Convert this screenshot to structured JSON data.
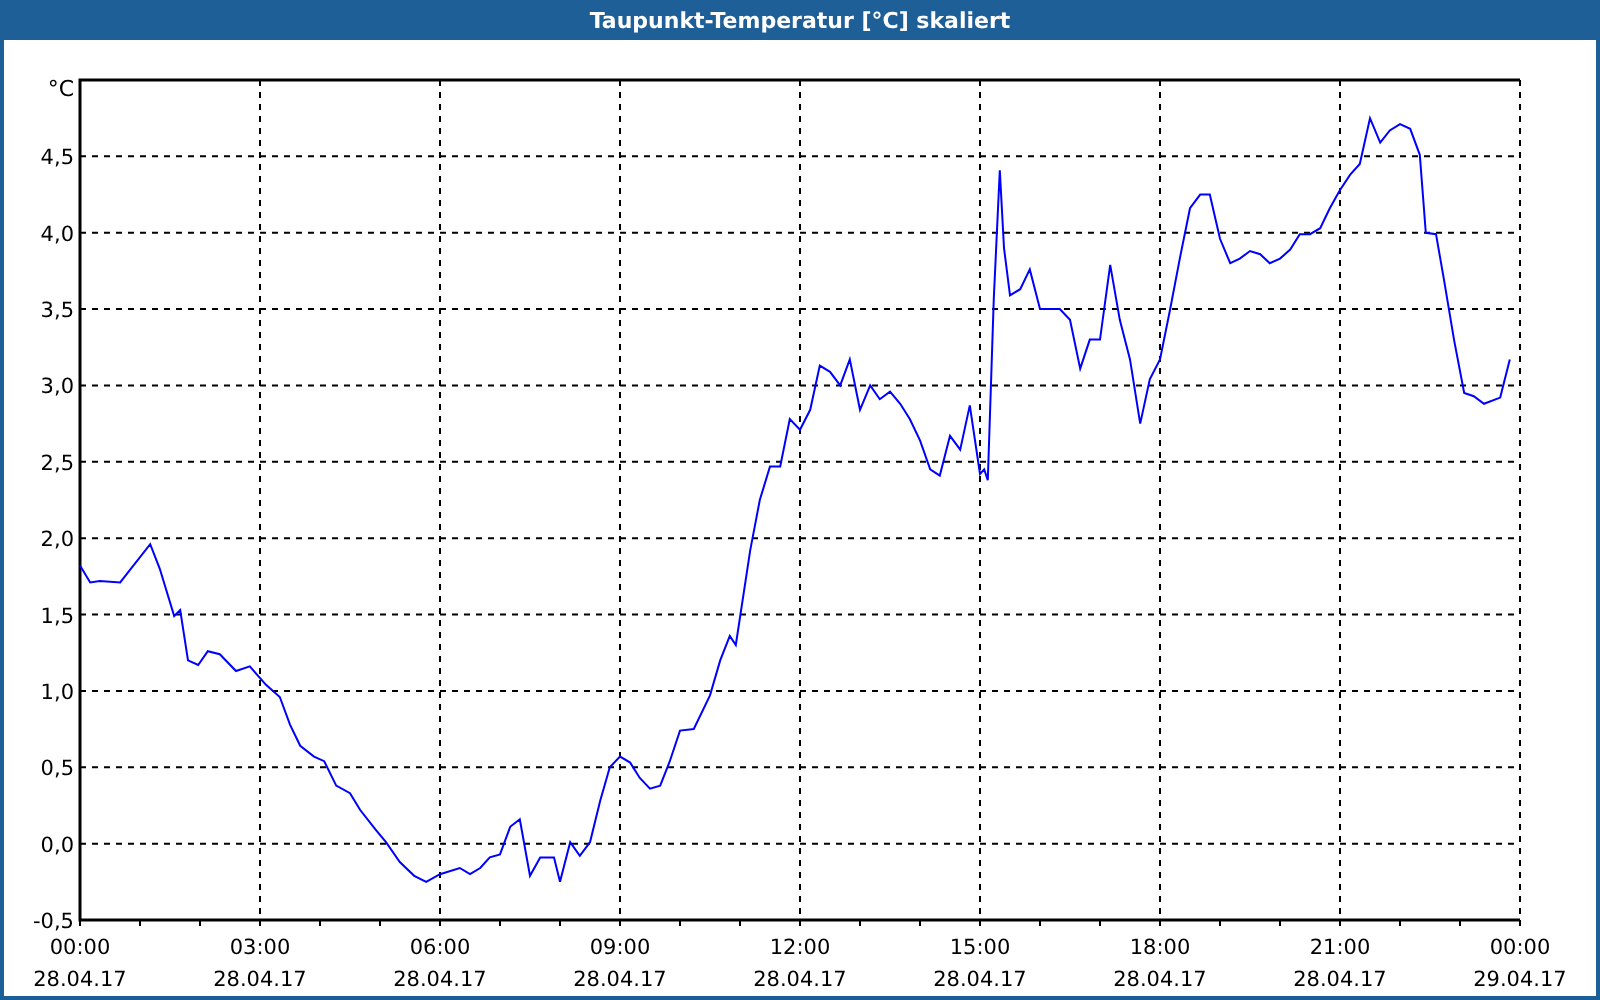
{
  "window": {
    "title": "Taupunkt-Temperatur [°C] skaliert"
  },
  "chart": {
    "chart_data": {
      "type": "line",
      "grid": true,
      "ylabel": "°C",
      "xlim": [
        0,
        24
      ],
      "ylim": [
        -0.5,
        5
      ],
      "xticks": [
        {
          "value": 0,
          "label": "00:00"
        },
        {
          "value": 3,
          "label": "03:00"
        },
        {
          "value": 6,
          "label": "06:00"
        },
        {
          "value": 9,
          "label": "09:00"
        },
        {
          "value": 12,
          "label": "12:00"
        },
        {
          "value": 15,
          "label": "15:00"
        },
        {
          "value": 18,
          "label": "18:00"
        },
        {
          "value": 21,
          "label": "21:00"
        },
        {
          "value": 24,
          "label": "00:00"
        }
      ],
      "yticks": [
        {
          "value": -0.5,
          "label": "-0,5"
        },
        {
          "value": 0,
          "label": "0,0"
        },
        {
          "value": 0.5,
          "label": "0,5"
        },
        {
          "value": 1,
          "label": "1,0"
        },
        {
          "value": 1.5,
          "label": "1,5"
        },
        {
          "value": 2,
          "label": "2,0"
        },
        {
          "value": 2.5,
          "label": "2,5"
        },
        {
          "value": 3,
          "label": "3,0"
        },
        {
          "value": 3.5,
          "label": "3,5"
        },
        {
          "value": 4,
          "label": "4,0"
        },
        {
          "value": 4.5,
          "label": "4,5"
        }
      ],
      "x": [
        0,
        0.17,
        0.33,
        0.67,
        0.83,
        1.17,
        1.33,
        1.57,
        1.67,
        1.8,
        1.97,
        2.13,
        2.33,
        2.6,
        2.83,
        3.1,
        3.33,
        3.5,
        3.67,
        3.9,
        4.07,
        4.27,
        4.5,
        4.67,
        4.93,
        5.1,
        5.33,
        5.57,
        5.77,
        6,
        6.33,
        6.5,
        6.67,
        6.83,
        7,
        7.17,
        7.33,
        7.5,
        7.67,
        7.9,
        8,
        8.17,
        8.33,
        8.5,
        8.67,
        8.83,
        9,
        9.17,
        9.33,
        9.5,
        9.67,
        9.83,
        10,
        10.23,
        10.5,
        10.67,
        10.83,
        10.93,
        11.17,
        11.33,
        11.5,
        11.67,
        11.83,
        12,
        12.17,
        12.33,
        12.5,
        12.67,
        12.83,
        13,
        13.17,
        13.33,
        13.5,
        13.67,
        13.83,
        14,
        14.17,
        14.33,
        14.5,
        14.67,
        14.83,
        15,
        15.07,
        15.13,
        15.23,
        15.33,
        15.4,
        15.5,
        15.67,
        15.83,
        16,
        16.33,
        16.5,
        16.67,
        16.83,
        17,
        17.17,
        17.33,
        17.5,
        17.67,
        17.83,
        18,
        18.17,
        18.33,
        18.5,
        18.67,
        18.83,
        19,
        19.17,
        19.33,
        19.5,
        19.67,
        19.83,
        20,
        20.17,
        20.33,
        20.5,
        20.67,
        20.83,
        21,
        21.17,
        21.33,
        21.5,
        21.67,
        21.83,
        22,
        22.17,
        22.33,
        22.43,
        22.6,
        22.73,
        22.9,
        23.07,
        23.23,
        23.4,
        23.67,
        23.83
      ],
      "series": [
        {
          "color": "#0000ff",
          "values": [
            1.82,
            1.71,
            1.72,
            1.71,
            1.79,
            1.96,
            1.8,
            1.49,
            1.53,
            1.2,
            1.17,
            1.26,
            1.24,
            1.13,
            1.16,
            1.04,
            0.96,
            0.78,
            0.64,
            0.57,
            0.54,
            0.38,
            0.33,
            0.22,
            0.09,
            0.01,
            -0.12,
            -0.21,
            -0.25,
            -0.2,
            -0.16,
            -0.2,
            -0.16,
            -0.09,
            -0.07,
            0.11,
            0.16,
            -0.21,
            -0.09,
            -0.09,
            -0.25,
            0.01,
            -0.08,
            0.01,
            0.28,
            0.5,
            0.57,
            0.53,
            0.43,
            0.36,
            0.38,
            0.54,
            0.74,
            0.75,
            0.97,
            1.2,
            1.36,
            1.3,
            1.92,
            2.25,
            2.47,
            2.47,
            2.78,
            2.71,
            2.84,
            3.13,
            3.09,
            3.0,
            3.17,
            2.84,
            3.0,
            2.91,
            2.96,
            2.88,
            2.78,
            2.64,
            2.45,
            2.41,
            2.67,
            2.58,
            2.87,
            2.42,
            2.45,
            2.38,
            3.57,
            4.41,
            3.9,
            3.59,
            3.63,
            3.76,
            3.5,
            3.5,
            3.43,
            3.11,
            3.3,
            3.3,
            3.79,
            3.43,
            3.17,
            2.75,
            3.04,
            3.17,
            3.5,
            3.83,
            4.16,
            4.25,
            4.25,
            3.96,
            3.8,
            3.83,
            3.88,
            3.86,
            3.8,
            3.83,
            3.89,
            3.99,
            3.99,
            4.03,
            4.16,
            4.28,
            4.38,
            4.45,
            4.75,
            4.59,
            4.67,
            4.71,
            4.68,
            4.51,
            4.0,
            3.99,
            3.7,
            3.3,
            2.95,
            2.93,
            2.88,
            2.92,
            3.17
          ]
        }
      ]
    },
    "xtick_dates": [
      "28.04.17",
      "28.04.17",
      "28.04.17",
      "28.04.17",
      "28.04.17",
      "28.04.17",
      "28.04.17",
      "28.04.17",
      "29.04.17"
    ]
  }
}
